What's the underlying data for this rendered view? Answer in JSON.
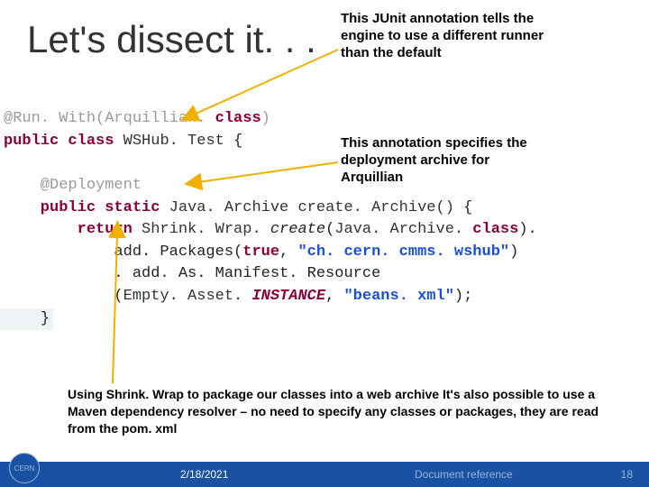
{
  "slide": {
    "title": "Let's dissect it. . ."
  },
  "annotations": {
    "runwith": "This JUnit annotation tells the engine to use a different runner than the default",
    "deployment": "This annotation specifies the deployment archive for Arquillian",
    "shrinkwrap": "Using Shrink. Wrap to package our classes into a web archive\nIt's also possible to use a Maven dependency resolver –  no need to specify any classes or packages, they are read from the pom. xml"
  },
  "code": {
    "l1_at": "@Run. With",
    "l1_paren_open": "(",
    "l1_arq": "Arquillian.",
    "l1_class": " class",
    "l1_paren_close": ")",
    "l2_public": "public ",
    "l2_class": "class ",
    "l2_name": "WSHub. Test ",
    "l2_brace": "{",
    "l3_at": "    @Deployment",
    "l4_publicstatic": "    public static ",
    "l4_type": "Java. Archive ",
    "l4_method": "create. Archive() ",
    "l4_brace": "{",
    "l5_return": "        return ",
    "l5_sw": "Shrink. Wrap.",
    "l5_create": " create",
    "l5_argopen": "(",
    "l5_ja": "Java. Archive.",
    "l5_class": " class",
    "l5_argclose": ").",
    "l6_add": "            add. Packages(",
    "l6_true": "true",
    "l6_comma": ", ",
    "l6_str": "\"ch. cern. cmms. wshub\"",
    "l6_close": ")",
    "l7_add": "            . add. As. Manifest. Resource",
    "l8_open": "            (",
    "l8_empty": "Empty. Asset.",
    "l8_inst": " INSTANCE",
    "l8_comma": ", ",
    "l8_str": "\"beans. xml\"",
    "l8_close": ");",
    "l9_close": "    }"
  },
  "footer": {
    "date": "2/18/2021",
    "reference": "Document reference",
    "page": "18",
    "logo": "CERN"
  }
}
